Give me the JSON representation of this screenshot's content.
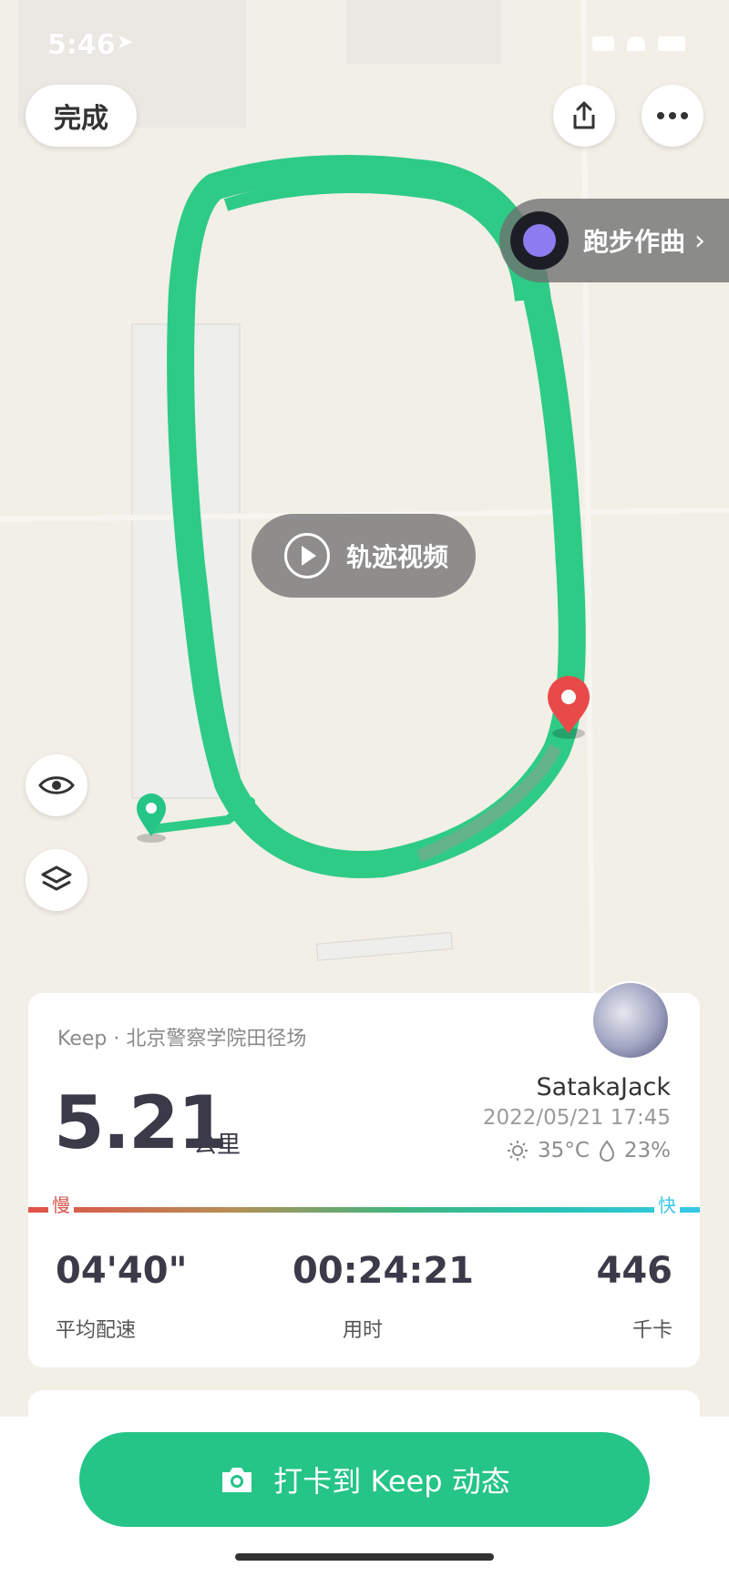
{
  "status_bar": {
    "time": "5:46"
  },
  "top": {
    "done_label": "完成"
  },
  "map": {
    "music_label": "跑步作曲",
    "video_label": "轨迹视频",
    "track_color": "#2ecb86",
    "start_marker_color": "#25c487",
    "end_marker_color": "#e84a4a"
  },
  "card": {
    "location": "Keep · 北京警察学院田径场",
    "distance": "5.21",
    "distance_unit": "公里",
    "username": "SatakaJack",
    "datetime": "2022/05/21 17:45",
    "temperature": "35°C",
    "humidity": "23%",
    "slow_label": "慢",
    "fast_label": "快",
    "stats": [
      {
        "value": "04'40\"",
        "label": "平均配速"
      },
      {
        "value": "00:24:21",
        "label": "用时"
      },
      {
        "value": "446",
        "label": "千卡"
      }
    ]
  },
  "bottom": {
    "checkin_label": "打卡到 Keep 动态"
  }
}
